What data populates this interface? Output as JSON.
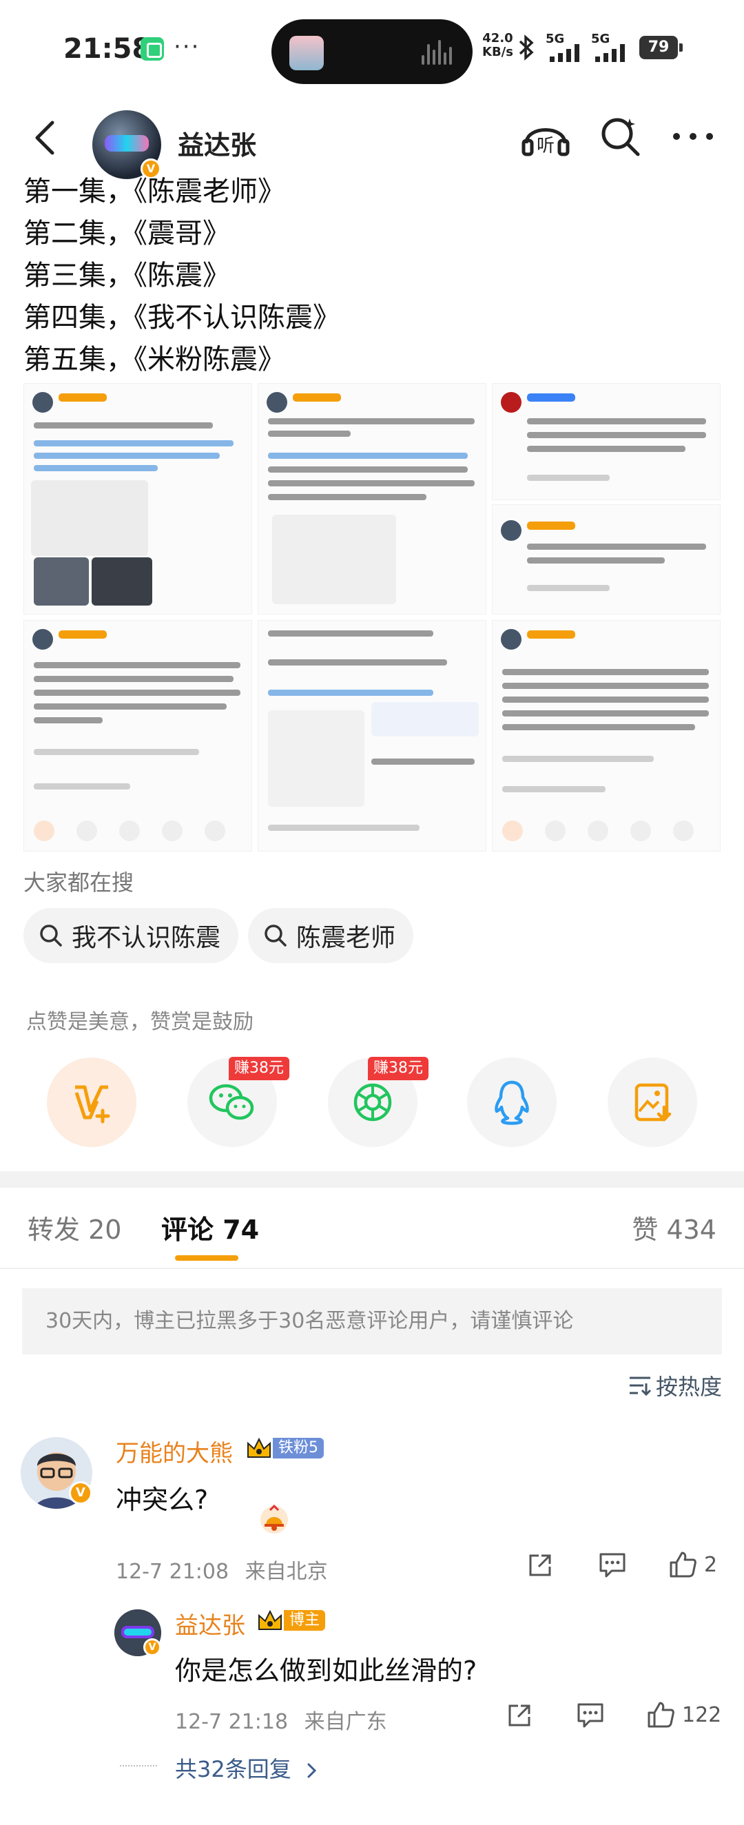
{
  "status_bar": {
    "time": "21:58",
    "more": "···",
    "net_speed_value": "42.0",
    "net_speed_unit": "KB/s",
    "signal1_label": "5G",
    "signal2_label": "5G",
    "battery": "79"
  },
  "header": {
    "title": "益达张",
    "listen_label": "听"
  },
  "post": {
    "lines": [
      "第一集，《陈震老师》",
      "第二集，《震哥》",
      "第三集，《陈震》",
      "第四集，《我不认识陈震》",
      "第五集，《米粉陈震》"
    ]
  },
  "search": {
    "title": "大家都在搜",
    "chips": [
      "我不认识陈震",
      "陈震老师"
    ]
  },
  "reward": {
    "title": "点赞是美意，赞赏是鼓励",
    "earn_badge_1": "赚38元",
    "earn_badge_2": "赚38元"
  },
  "tabs": {
    "repost": "转发 20",
    "comments": "评论 74",
    "likes": "赞 434"
  },
  "notice": "30天内，博主已拉黑多于30名恶意评论用户，请谨慎评论",
  "sort_label": "按热度",
  "comments": [
    {
      "name": "万能的大熊",
      "badge": "铁粉5",
      "text": "冲突么?",
      "time": "12-7 21:08",
      "location": "来自北京",
      "likes": "2"
    }
  ],
  "reply": {
    "name": "益达张",
    "badge": "博主",
    "text": "你是怎么做到如此丝滑的?",
    "time": "12-7 21:18",
    "location": "来自广东",
    "likes": "122"
  },
  "more_replies": "共32条回复",
  "colors": {
    "accent_orange": "#f59e0b",
    "name_orange": "#e8821c",
    "earn_red": "#ef3a3a",
    "link_blue": "#3b5b8a"
  }
}
